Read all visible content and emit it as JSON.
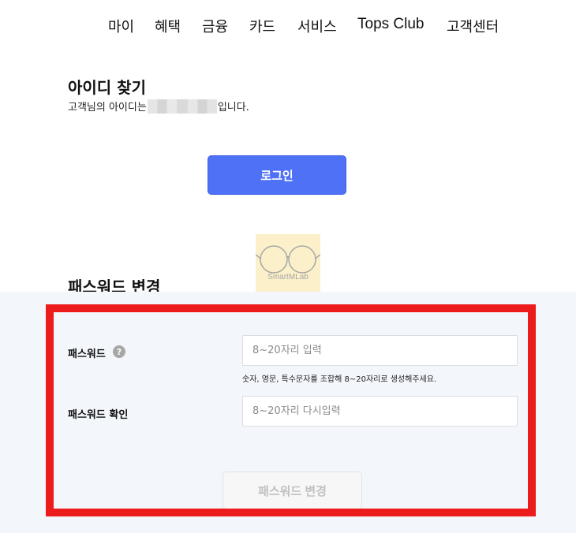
{
  "nav": {
    "items": [
      {
        "label": "마이"
      },
      {
        "label": "혜택"
      },
      {
        "label": "금융"
      },
      {
        "label": "카드"
      },
      {
        "label": "서비스"
      },
      {
        "label": "Tops Club"
      },
      {
        "label": "고객센터"
      }
    ]
  },
  "find_id": {
    "title": "아이디 찾기",
    "message_prefix": "고객님의 아이디는",
    "message_suffix": "입니다.",
    "login_button": "로그인"
  },
  "watermark": {
    "text": "SmartMLab"
  },
  "password_change": {
    "title": "패스워드 변경",
    "password_label": "패스워드",
    "help_icon_text": "?",
    "password_placeholder": "8~20자리 입력",
    "guide": "숫자, 영문, 특수문자를 조합해 8~20자리로 생성해주세요.",
    "confirm_label": "패스워드 확인",
    "confirm_placeholder": "8~20자리 다시입력",
    "button": "패스워드 변경"
  },
  "colors": {
    "primary_button": "#4f71f6",
    "highlight_border": "#ed1c1c",
    "panel_background": "#f3f6fb",
    "disabled_text": "#c1c1c1"
  }
}
